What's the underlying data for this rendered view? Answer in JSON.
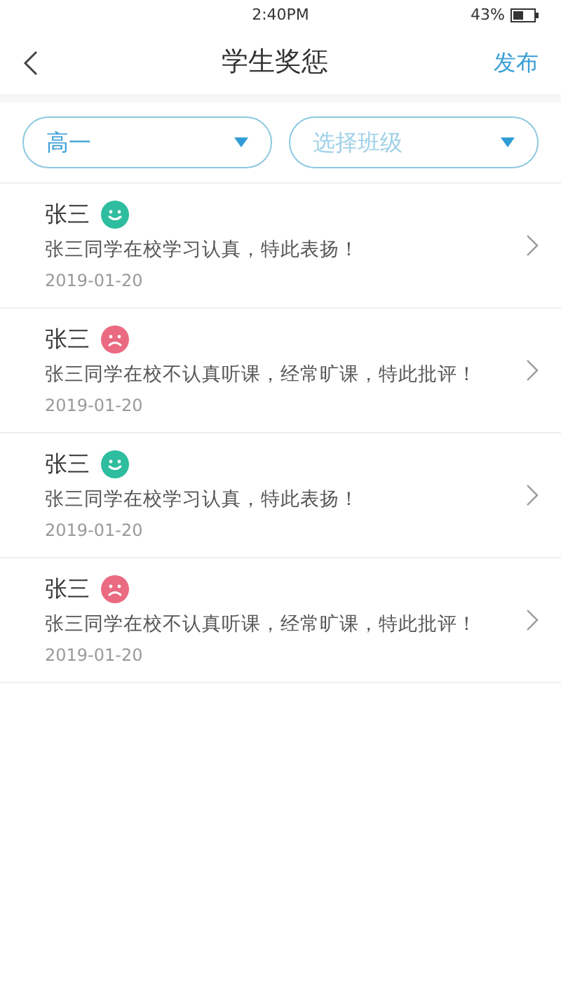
{
  "status_bar": {
    "time": "2:40PM",
    "battery": "43%"
  },
  "header": {
    "title": "学生奖惩",
    "action": "发布"
  },
  "filters": [
    {
      "value": "高一"
    },
    {
      "placeholder": "选择班级"
    }
  ],
  "records": [
    {
      "name": "张三",
      "kind": "praise",
      "color": "#2ebd9e",
      "text": "张三同学在校学习认真，特此表扬！",
      "date": "2019-01-20"
    },
    {
      "name": "张三",
      "kind": "criticism",
      "color": "#ea6a82",
      "text": "张三同学在校不认真听课，经常旷课，特此批评！",
      "date": "2019-01-20"
    },
    {
      "name": "张三",
      "kind": "praise",
      "color": "#2ebd9e",
      "text": "张三同学在校学习认真，特此表扬！",
      "date": "2019-01-20"
    },
    {
      "name": "张三",
      "kind": "criticism",
      "color": "#ea6a82",
      "text": "张三同学在校不认真听课，经常旷课，特此批评！",
      "date": "2019-01-20"
    }
  ]
}
